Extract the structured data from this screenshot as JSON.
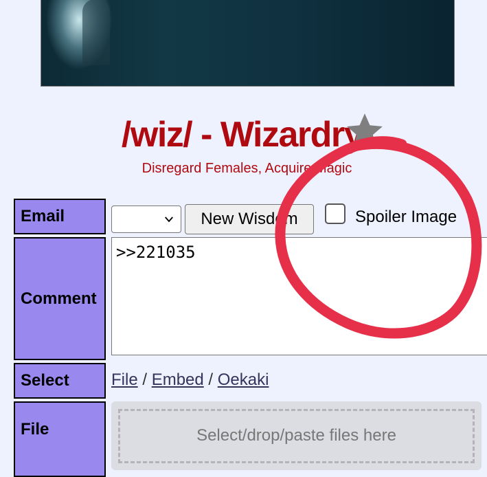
{
  "board": {
    "title": "/wiz/ - Wizardry",
    "subtitle": "Disregard Females, Acquire Magic"
  },
  "form": {
    "email_label": "Email",
    "email_selected": "",
    "new_wisdom_button": "New Wisdom",
    "spoiler_label": "Spoiler Image",
    "comment_label": "Comment",
    "comment_value": ">>221035",
    "select_label": "Select",
    "select_links": {
      "file": "File",
      "embed": "Embed",
      "oekaki": "Oekaki",
      "separator": "/"
    },
    "file_label": "File",
    "file_drop_text": "Select/drop/paste files here"
  },
  "icons": {
    "favorite": "star-icon",
    "dropdown": "chevron-down-icon"
  },
  "colors": {
    "background": "#eef2ff",
    "title": "#af0a0f",
    "label_cell": "#9988ee",
    "annotation": "#e6304a"
  }
}
